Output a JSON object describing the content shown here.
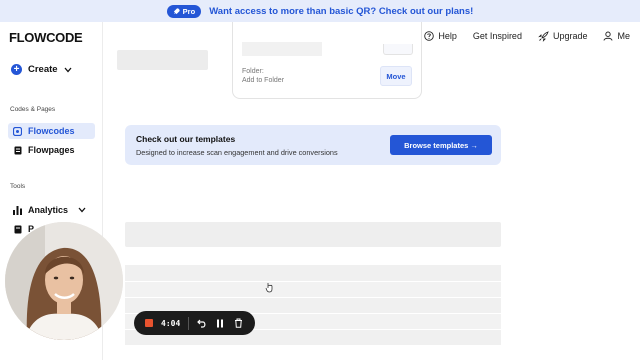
{
  "banner": {
    "pro_label": "Pro",
    "text": "Want access to more than basic QR? Check out our plans!",
    "accent": "#2456d6"
  },
  "sidebar": {
    "logo": "FLOWCODE",
    "create_label": "Create",
    "codes_section": "Codes & Pages",
    "items": [
      {
        "label": "Flowcodes",
        "icon": "qr-icon",
        "active": true
      },
      {
        "label": "Flowpages",
        "icon": "page-icon",
        "active": false
      }
    ],
    "tools_section": "Tools",
    "tools": [
      {
        "label": "Analytics",
        "icon": "bar-chart-icon"
      },
      {
        "label": "P",
        "icon": "document-icon"
      }
    ]
  },
  "topnav": {
    "help": "Help",
    "inspired": "Get Inspired",
    "upgrade": "Upgrade",
    "me": "Me"
  },
  "folder_card": {
    "folder_label": "Folder:",
    "folder_value": "Add to Folder",
    "move_label": "Move"
  },
  "templates": {
    "title": "Check out our templates",
    "subtitle": "Designed to increase scan engagement and drive conversions",
    "button": "Browse templates →"
  },
  "recorder": {
    "time": "4:04"
  }
}
